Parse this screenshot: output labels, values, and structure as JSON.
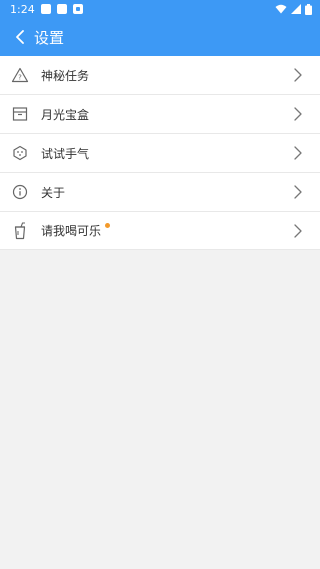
{
  "status_bar": {
    "time": "1:24"
  },
  "app_bar": {
    "title": "设置",
    "back_icon": "chevron-left-icon"
  },
  "menu": {
    "items": [
      {
        "label": "神秘任务",
        "icon": "triangle-question-icon"
      },
      {
        "label": "月光宝盒",
        "icon": "box-icon"
      },
      {
        "label": "试试手气",
        "icon": "dice-icon"
      },
      {
        "label": "关于",
        "icon": "info-icon"
      },
      {
        "label": "请我喝可乐",
        "icon": "cola-cup-icon",
        "badge_color": "#f39a2b"
      }
    ]
  },
  "colors": {
    "accent": "#3d99f5",
    "background": "#f2f2f2",
    "badge": "#f39a2b"
  }
}
